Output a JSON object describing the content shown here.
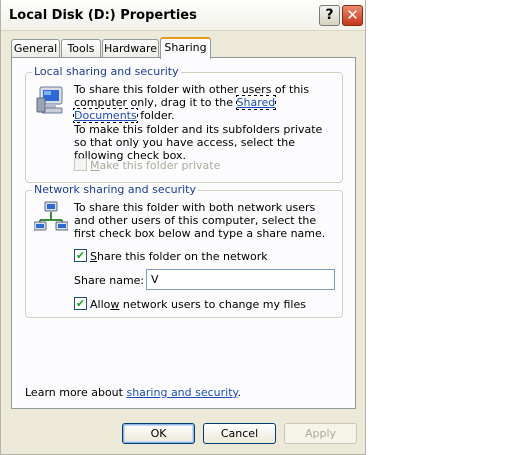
{
  "window": {
    "title": "Local Disk (D:) Properties",
    "help_label": "?",
    "close_label": "✕"
  },
  "tabs": [
    {
      "label": "General"
    },
    {
      "label": "Tools"
    },
    {
      "label": "Hardware"
    },
    {
      "label": "Sharing",
      "active": true
    }
  ],
  "local_sharing": {
    "legend": "Local sharing and security",
    "icon": "computer-icon",
    "text1_pre": "To share this folder with other users of this computer only, drag it to the ",
    "text1_link": "Shared Documents",
    "text1_post": " folder.",
    "text2": "To make this folder and its subfolders private so that only you have access, select the following check box.",
    "private_label_prefix": "M",
    "private_label_rest": "ake this folder private",
    "private_checked": false,
    "private_enabled": false
  },
  "network_sharing": {
    "legend": "Network sharing and security",
    "icon": "network-computers-icon",
    "text": "To share this folder with both network users and other users of this computer, select the first check box below and type a share name.",
    "share_label_prefix": "S",
    "share_label_rest": "hare this folder on the network",
    "share_checked": true,
    "share_name_label": "Share name:",
    "share_name_value": "V",
    "allow_label_pre": "Allo",
    "allow_label_acc": "w",
    "allow_label_rest": " network users to change my files",
    "allow_checked": true,
    "check_mark": "✔"
  },
  "learn_more": {
    "prefix": "Learn more about ",
    "link": "sharing and security",
    "suffix": "."
  },
  "buttons": {
    "ok": "OK",
    "cancel": "Cancel",
    "apply": "Apply"
  }
}
